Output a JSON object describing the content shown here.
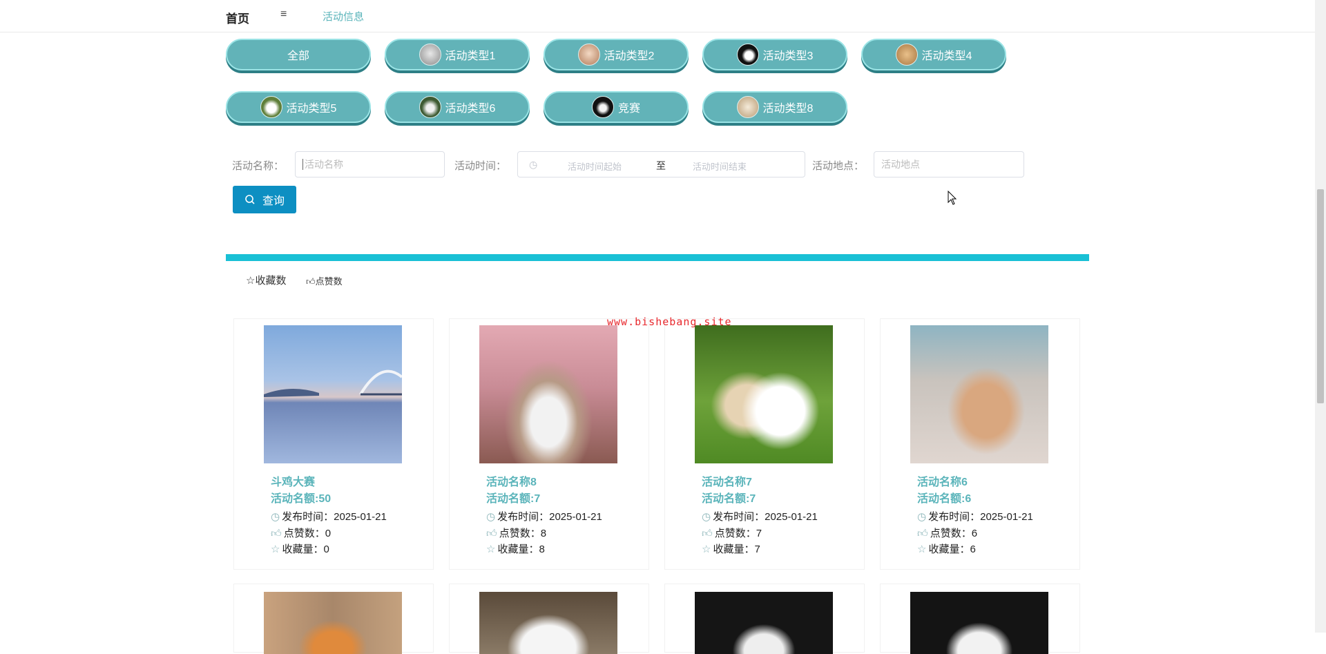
{
  "nav": {
    "home": "首页",
    "menu_icon": "≡",
    "active": "活动信息"
  },
  "categories": [
    {
      "label": "全部",
      "has_thumb": false
    },
    {
      "label": "活动类型1",
      "has_thumb": true
    },
    {
      "label": "活动类型2",
      "has_thumb": true
    },
    {
      "label": "活动类型3",
      "has_thumb": true
    },
    {
      "label": "活动类型4",
      "has_thumb": true
    },
    {
      "label": "活动类型5",
      "has_thumb": true
    },
    {
      "label": "活动类型6",
      "has_thumb": true
    },
    {
      "label": "竞赛",
      "has_thumb": true
    },
    {
      "label": "活动类型8",
      "has_thumb": true
    }
  ],
  "search": {
    "name_label": "活动名称：",
    "name_placeholder": "活动名称",
    "time_label": "活动时间：",
    "time_start_placeholder": "活动时间起始",
    "time_separator": "至",
    "time_end_placeholder": "活动时间结束",
    "place_label": "活动地点：",
    "place_placeholder": "活动地点",
    "query_button": "查询"
  },
  "sort": {
    "favorites": "收藏数",
    "likes": "点赞数"
  },
  "watermark": "www.bishebang.site",
  "card_labels": {
    "publish": "发布时间：",
    "likes": "点赞数：",
    "favorites": "收藏量："
  },
  "cards": [
    {
      "name": "斗鸡大赛",
      "quota": "活动名额:50",
      "date": "2025-01-21",
      "likes": "0",
      "favorites": "0"
    },
    {
      "name": "活动名称8",
      "quota": "活动名额:7",
      "date": "2025-01-21",
      "likes": "8",
      "favorites": "8"
    },
    {
      "name": "活动名称7",
      "quota": "活动名额:7",
      "date": "2025-01-21",
      "likes": "7",
      "favorites": "7"
    },
    {
      "name": "活动名称6",
      "quota": "活动名额:6",
      "date": "2025-01-21",
      "likes": "6",
      "favorites": "6"
    }
  ],
  "colors": {
    "accent": "#62b3b8",
    "divider": "#19c0d5",
    "button": "#0d8fc2",
    "watermark": "#e8282d"
  }
}
